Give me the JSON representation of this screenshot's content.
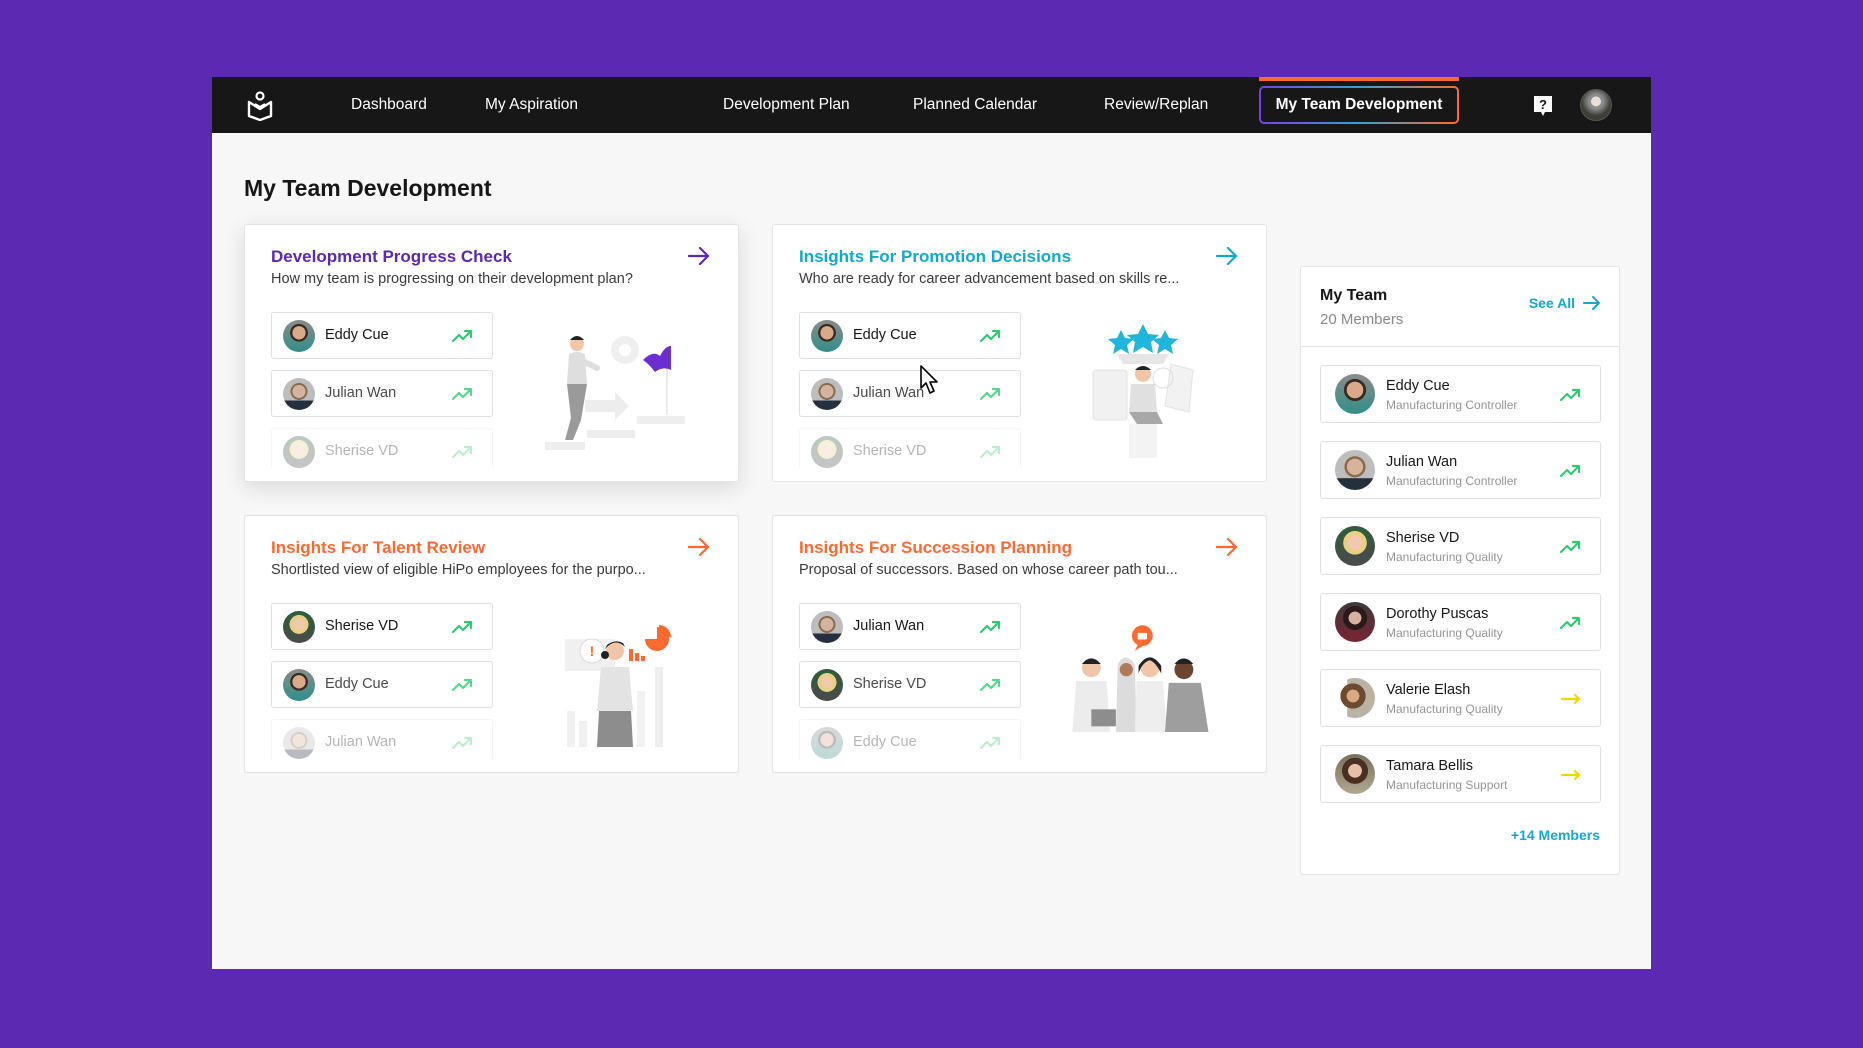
{
  "nav": {
    "items": [
      {
        "label": "Dashboard"
      },
      {
        "label": "My Aspiration"
      },
      {
        "label": "Development Plan"
      },
      {
        "label": "Planned Calendar"
      },
      {
        "label": "Review/Replan"
      }
    ],
    "active": "My Team Development",
    "logo_icon": "book-person-logo",
    "help_icon": "help-question-icon",
    "avatar": "user-avatar"
  },
  "page": {
    "title": "My Team Development"
  },
  "cards": [
    {
      "title": "Development Progress Check",
      "description": "How my team is progressing on their development plan?",
      "color": "#5c29b3",
      "members": [
        {
          "name": "Eddy Cue",
          "trend": "up"
        },
        {
          "name": "Julian Wan",
          "trend": "up"
        },
        {
          "name": "Sherise VD",
          "trend": "up"
        }
      ]
    },
    {
      "title": "Insights For Promotion Decisions",
      "description": "Who are ready for career advancement based on skills re...",
      "color": "#13a9c9",
      "members": [
        {
          "name": "Eddy Cue",
          "trend": "up"
        },
        {
          "name": "Julian Wan",
          "trend": "up"
        },
        {
          "name": "Sherise VD",
          "trend": "up"
        }
      ]
    },
    {
      "title": "Insights For Talent Review",
      "description": "Shortlisted view of eligible HiPo employees for the purpo...",
      "color": "#ff6a33",
      "members": [
        {
          "name": "Sherise VD",
          "trend": "up"
        },
        {
          "name": "Eddy Cue",
          "trend": "up"
        },
        {
          "name": "Julian Wan",
          "trend": "up"
        }
      ]
    },
    {
      "title": "Insights For Succession Planning",
      "description": "Proposal of successors. Based on whose career path tou...",
      "color": "#ff6a33",
      "members": [
        {
          "name": "Julian Wan",
          "trend": "up"
        },
        {
          "name": "Sherise VD",
          "trend": "up"
        },
        {
          "name": "Eddy Cue",
          "trend": "up"
        }
      ]
    }
  ],
  "team": {
    "title": "My Team",
    "count": "20 Members",
    "see_all": "See All",
    "more": "+14 Members",
    "members": [
      {
        "name": "Eddy Cue",
        "role": "Manufacturing Controller",
        "trend": "up"
      },
      {
        "name": "Julian Wan",
        "role": "Manufacturing Controller",
        "trend": "up"
      },
      {
        "name": "Sherise VD",
        "role": "Manufacturing Quality",
        "trend": "up"
      },
      {
        "name": "Dorothy Puscas",
        "role": "Manufacturing Quality",
        "trend": "up"
      },
      {
        "name": "Valerie Elash",
        "role": "Manufacturing Quality",
        "trend": "flat"
      },
      {
        "name": "Tamara Bellis",
        "role": "Manufacturing Support",
        "trend": "flat"
      }
    ]
  },
  "colors": {
    "background": "#5c29b3",
    "nav": "#171717",
    "trend_up": "#2ecc71",
    "trend_flat": "#f2d600",
    "link": "#13a9c9"
  }
}
